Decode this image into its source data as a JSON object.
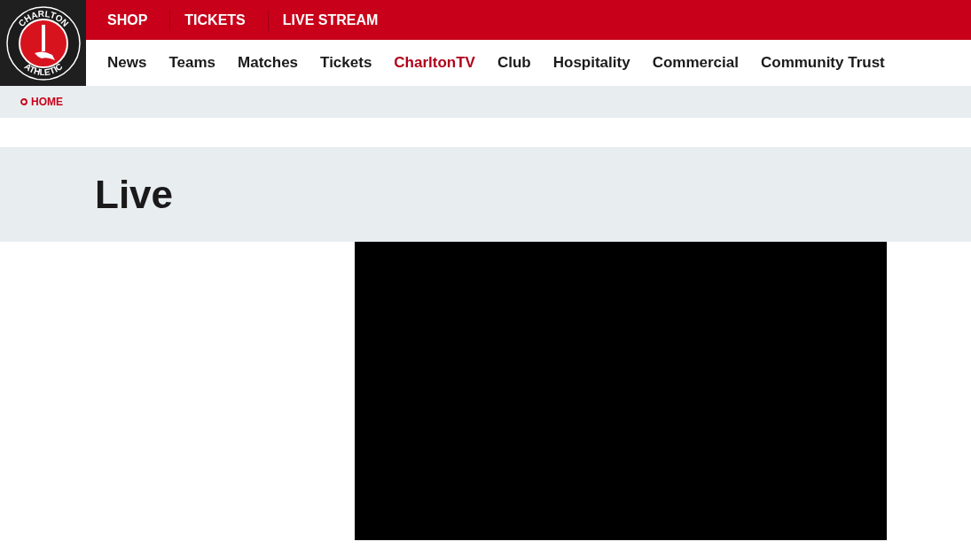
{
  "logo": {
    "top_text": "CHARLTON",
    "bottom_text": "ATHLETIC"
  },
  "top_links": [
    {
      "label": "SHOP"
    },
    {
      "label": "TICKETS"
    },
    {
      "label": "LIVE STREAM"
    }
  ],
  "nav": [
    {
      "label": "News",
      "selected": false
    },
    {
      "label": "Teams",
      "selected": false
    },
    {
      "label": "Matches",
      "selected": false
    },
    {
      "label": "Tickets",
      "selected": false
    },
    {
      "label": "CharltonTV",
      "selected": true
    },
    {
      "label": "Club",
      "selected": false
    },
    {
      "label": "Hospitality",
      "selected": false
    },
    {
      "label": "Commercial",
      "selected": false
    },
    {
      "label": "Community Trust",
      "selected": false
    }
  ],
  "breadcrumb": [
    {
      "label": "HOME"
    }
  ],
  "page_title": "Live",
  "video": {
    "kind": "video"
  }
}
